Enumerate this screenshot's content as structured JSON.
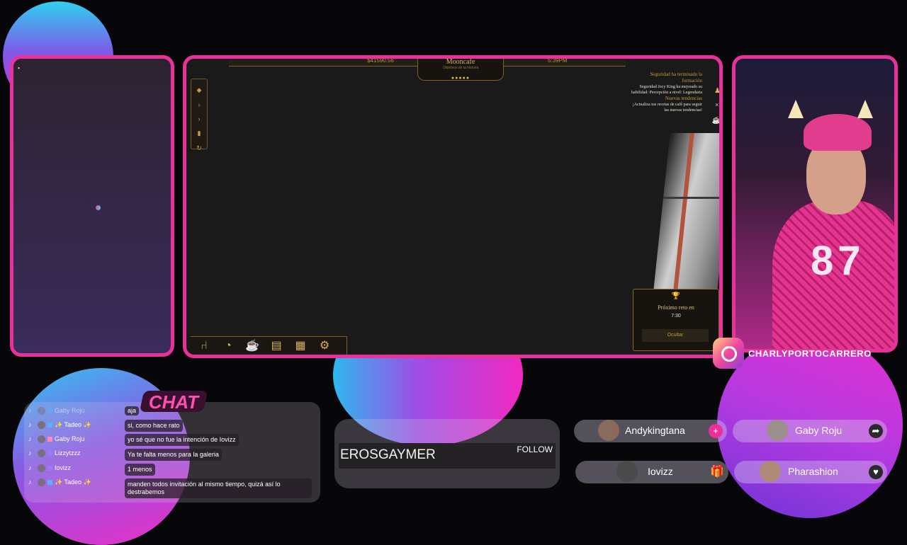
{
  "game": {
    "title": "Mooncafe",
    "subtitle": "Objetivos de la historia",
    "stars": "●●●●●",
    "money": "$41590.56",
    "clock": "5:39PM",
    "notification": {
      "heading1": "Seguridad ha terminado la formación",
      "body1": "Seguridad Jocy King ha mejorado su habilidad: Percepción a nivel: Legendaria",
      "heading2": "Nuevas tendencias",
      "body2": "¡Actualiza tus recetas de café para seguir las nuevas tendencias!"
    },
    "challenge": {
      "label": "Próximo reto en",
      "time": "7:30",
      "button": "Ocultar"
    },
    "toolbar_icons": [
      "chair-icon",
      "croissant-icon",
      "coffee-icon",
      "menu-icon",
      "hallway-icon",
      "gear-icon"
    ]
  },
  "social": {
    "handle": "CHARLYPORTOCARRERO"
  },
  "chat": {
    "tag": "CHAT",
    "rows": [
      {
        "user": "Gaby Roju",
        "message": "aja"
      },
      {
        "user": "✨ Tadeo ✨",
        "message": "si, como hace rato"
      },
      {
        "user": "Gaby Roju",
        "message": "yo sé que no fue la intención de Iovizz"
      },
      {
        "user": "Lizzytzzz",
        "message": "Ya te falta menos para la galeria"
      },
      {
        "user": "Iovizz",
        "message": "1 menos"
      },
      {
        "user": "✨ Tadeo ✨",
        "message": "manden todos invitación al mismo tiempo, quizá así lo destrabemos"
      }
    ]
  },
  "streamer_card": {
    "name": "EROSGAYMER",
    "follow": "FOLLOW"
  },
  "pills": [
    {
      "name": "Andykingtana",
      "icon": "+",
      "icon_name": "plus-icon",
      "color": "#e8319b"
    },
    {
      "name": "Gaby Roju",
      "icon": "➦",
      "icon_name": "share-icon",
      "color": "#2a2a2a"
    },
    {
      "name": "Iovizz",
      "icon": "🎁",
      "icon_name": "gift-icon",
      "color": "transparent"
    },
    {
      "name": "Pharashion",
      "icon": "♥",
      "icon_name": "heart-icon",
      "color": "#2a2a2a"
    }
  ],
  "colors": {
    "frame": "#e8319b",
    "game_gold": "#d9b05a"
  }
}
